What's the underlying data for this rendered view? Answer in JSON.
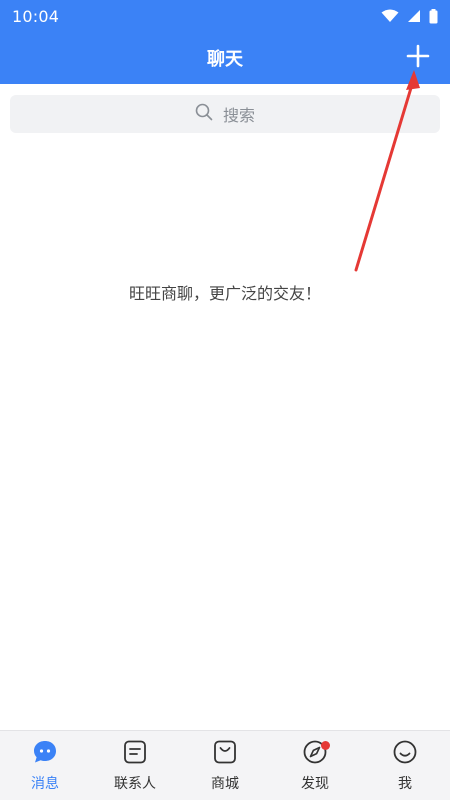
{
  "status_bar": {
    "time": "10:04",
    "icons": [
      "wifi-icon",
      "cellular-icon",
      "battery-icon"
    ]
  },
  "header": {
    "title": "聊天",
    "add_icon": "plus-icon"
  },
  "search": {
    "placeholder": "搜索",
    "icon": "search-icon"
  },
  "empty_message": "旺旺商聊，更广泛的交友！",
  "bottom_nav": {
    "items": [
      {
        "label": "消息",
        "icon": "chat-bubble-icon",
        "active": true
      },
      {
        "label": "联系人",
        "icon": "contacts-icon",
        "active": false
      },
      {
        "label": "商城",
        "icon": "store-icon",
        "active": false
      },
      {
        "label": "发现",
        "icon": "compass-icon",
        "active": false,
        "badge": true
      },
      {
        "label": "我",
        "icon": "smiley-icon",
        "active": false
      }
    ]
  },
  "colors": {
    "primary": "#3B82F6",
    "badge": "#E53935",
    "annotation": "#E53935",
    "search_bg": "#F1F2F4",
    "nav_bg": "#F4F4F6"
  }
}
